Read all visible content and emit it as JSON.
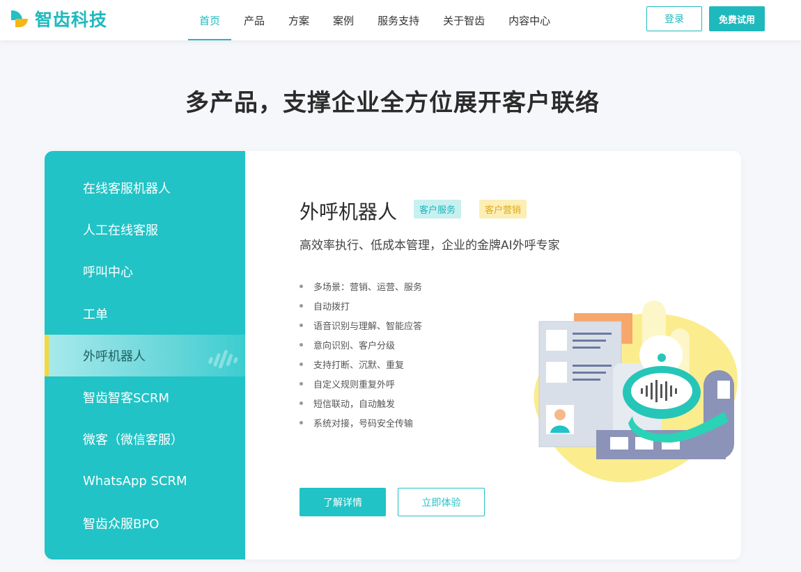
{
  "header": {
    "logo_text": "智齿科技",
    "nav": [
      {
        "label": "首页",
        "active": true
      },
      {
        "label": "产品",
        "active": false
      },
      {
        "label": "方案",
        "active": false
      },
      {
        "label": "案例",
        "active": false
      },
      {
        "label": "服务支持",
        "active": false
      },
      {
        "label": "关于智齿",
        "active": false
      },
      {
        "label": "内容中心",
        "active": false
      }
    ],
    "login_label": "登录",
    "trial_label": "免费试用"
  },
  "page_title": "多产品，支撑企业全方位展开客户联络",
  "sidebar": {
    "items": [
      {
        "label": "在线客服机器人"
      },
      {
        "label": "人工在线客服"
      },
      {
        "label": "呼叫中心"
      },
      {
        "label": "工单"
      },
      {
        "label": "外呼机器人",
        "active": true
      },
      {
        "label": "智齿智客SCRM"
      },
      {
        "label": "微客（微信客服）"
      },
      {
        "label": "WhatsApp SCRM"
      },
      {
        "label": "智齿众服BPO"
      }
    ]
  },
  "product": {
    "title": "外呼机器人",
    "tags": [
      "客户服务",
      "客户营销"
    ],
    "subtitle": "高效率执行、低成本管理，企业的金牌AI外呼专家",
    "features": [
      "多场景：营销、运营、服务",
      "自动拨打",
      "语音识别与理解、智能应答",
      "意向识别、客户分级",
      "支持打断、沉默、重复",
      "自定义规则重复外呼",
      "短信联动，自动触发",
      "系统对接，号码安全传输"
    ],
    "detail_label": "了解详情",
    "try_label": "立即体验"
  },
  "colors": {
    "brand": "#21c3c6",
    "accent_yellow": "#f3d83b"
  }
}
